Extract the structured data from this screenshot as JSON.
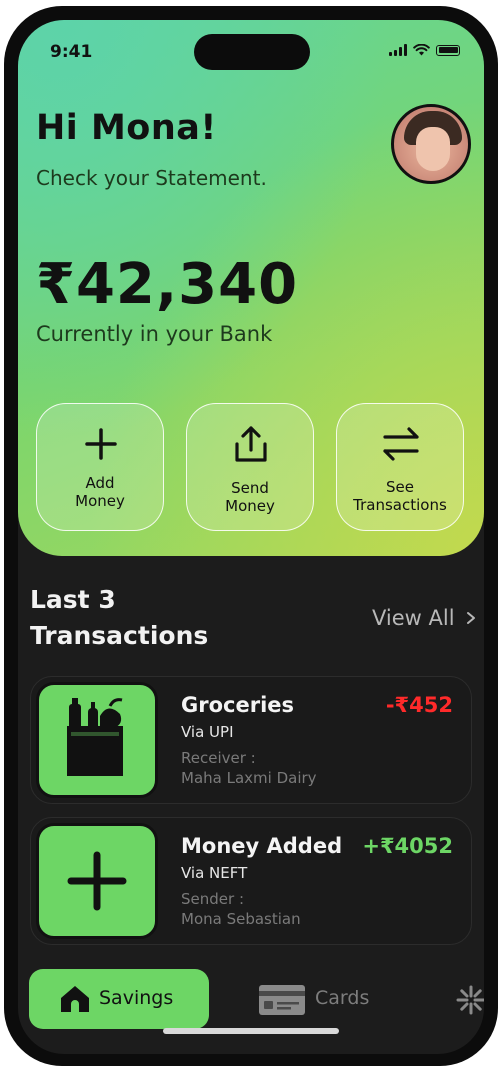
{
  "status_bar": {
    "time": "9:41"
  },
  "header": {
    "greeting": "Hi Mona!",
    "subtitle": "Check your Statement."
  },
  "balance": {
    "amount": "₹42,340",
    "caption": "Currently in your Bank"
  },
  "actions": [
    {
      "label_line1": "Add",
      "label_line2": "Money",
      "icon": "plus-icon"
    },
    {
      "label_line1": "Send",
      "label_line2": "Money",
      "icon": "share-upload-icon"
    },
    {
      "label_line1": "See",
      "label_line2": "Transactions",
      "icon": "swap-arrows-icon"
    }
  ],
  "transactions_section": {
    "title_line1": "Last 3",
    "title_line2": "Transactions",
    "view_all": "View All",
    "items": [
      {
        "title": "Groceries",
        "via": "Via UPI",
        "role": "Receiver :",
        "party": "Maha Laxmi Dairy",
        "amount": "-₹452",
        "amount_color": "#ff2a2a",
        "icon": "grocery-bag-icon"
      },
      {
        "title": "Money Added",
        "via": "Via NEFT",
        "role": "Sender :",
        "party": "Mona Sebastian",
        "amount": "+₹4052",
        "amount_color": "#6dd665",
        "icon": "plus-icon"
      }
    ]
  },
  "bottom_nav": {
    "items": [
      {
        "label": "Savings",
        "icon": "home-icon",
        "active": true
      },
      {
        "label": "Cards",
        "icon": "credit-card-icon",
        "active": false
      },
      {
        "label": "",
        "icon": "sparkle-icon",
        "active": false
      }
    ]
  },
  "colors": {
    "accent": "#6dd665",
    "background": "#1c1c1c",
    "negative": "#ff2a2a"
  }
}
